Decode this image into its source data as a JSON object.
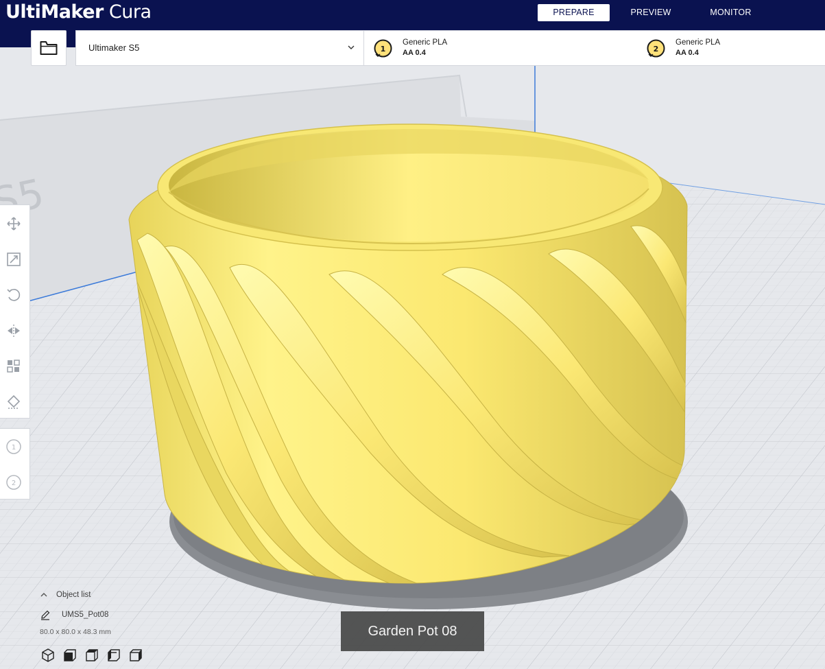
{
  "app": {
    "brand_bold": "UltiMaker",
    "brand_light": "Cura"
  },
  "stages": {
    "prepare": "PREPARE",
    "preview": "PREVIEW",
    "monitor": "MONITOR",
    "active": "prepare"
  },
  "machine": {
    "name": "Ultimaker S5"
  },
  "extruders": [
    {
      "index": "1",
      "material": "Generic PLA",
      "nozzle": "AA 0.4"
    },
    {
      "index": "2",
      "material": "Generic PLA",
      "nozzle": "AA 0.4"
    }
  ],
  "toolbar": {
    "tools": [
      "move-icon",
      "scale-icon",
      "rotate-icon",
      "mirror-icon",
      "per-model-settings-icon",
      "support-blocker-icon"
    ],
    "extruder_tools": [
      "1",
      "2"
    ]
  },
  "object_list": {
    "label": "Object list",
    "object_name": "UMS5_Pot08",
    "dimensions": "80.0 x 80.0 x 48.3 mm",
    "view_buttons": [
      "3d-view-icon",
      "front-view-icon",
      "top-view-icon",
      "left-view-icon",
      "right-view-icon"
    ]
  },
  "build_volume_label": "S5",
  "caption": "Garden Pot 08",
  "colors": {
    "header": "#0a1250",
    "model_yellow": "#fff17a",
    "model_shadow": "#d9c44a",
    "plate": "#e6e8ec",
    "grid": "#c8ccd2",
    "accent_blue": "#3b7ad9"
  }
}
